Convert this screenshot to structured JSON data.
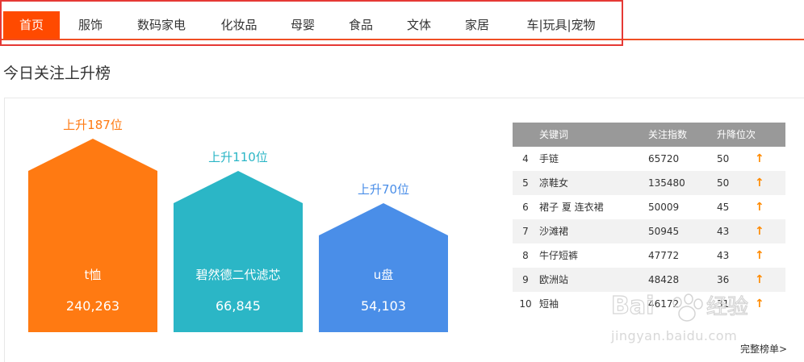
{
  "nav": {
    "tabs": [
      {
        "label": "首页",
        "active": true
      },
      {
        "label": "服饰"
      },
      {
        "label": "数码家电"
      },
      {
        "label": "化妆品"
      },
      {
        "label": "母婴"
      },
      {
        "label": "食品"
      },
      {
        "label": "文体"
      },
      {
        "label": "家居"
      },
      {
        "label": "车|玩具|宠物"
      }
    ]
  },
  "section_title": "今日关注上升榜",
  "top3": [
    {
      "rise": "上升187位",
      "name": "t恤",
      "value": "240,263",
      "color": "#ff7a12"
    },
    {
      "rise": "上升110位",
      "name": "碧然德二代滤芯",
      "value": "66,845",
      "color": "#2bb6c6"
    },
    {
      "rise": "上升70位",
      "name": "u盘",
      "value": "54,103",
      "color": "#4a8ee8"
    }
  ],
  "table": {
    "headers": {
      "keyword": "关键词",
      "index": "关注指数",
      "change": "升降位次"
    },
    "rows": [
      {
        "rank": "4",
        "keyword": "手链",
        "index": "65720",
        "change": "50",
        "arrow": "↑"
      },
      {
        "rank": "5",
        "keyword": "凉鞋女",
        "index": "135480",
        "change": "50",
        "arrow": "↑"
      },
      {
        "rank": "6",
        "keyword": "裙子 夏 连衣裙",
        "index": "50009",
        "change": "45",
        "arrow": "↑"
      },
      {
        "rank": "7",
        "keyword": "沙滩裙",
        "index": "50945",
        "change": "43",
        "arrow": "↑"
      },
      {
        "rank": "8",
        "keyword": "牛仔短裤",
        "index": "47772",
        "change": "43",
        "arrow": "↑"
      },
      {
        "rank": "9",
        "keyword": "欧洲站",
        "index": "48428",
        "change": "36",
        "arrow": "↑"
      },
      {
        "rank": "10",
        "keyword": "短袖",
        "index": "46172",
        "change": "31",
        "arrow": "↑"
      }
    ]
  },
  "more_link": "完整榜单>",
  "watermark": {
    "brand": "Bai du 经验",
    "url": "jingyan.baidu.com"
  }
}
